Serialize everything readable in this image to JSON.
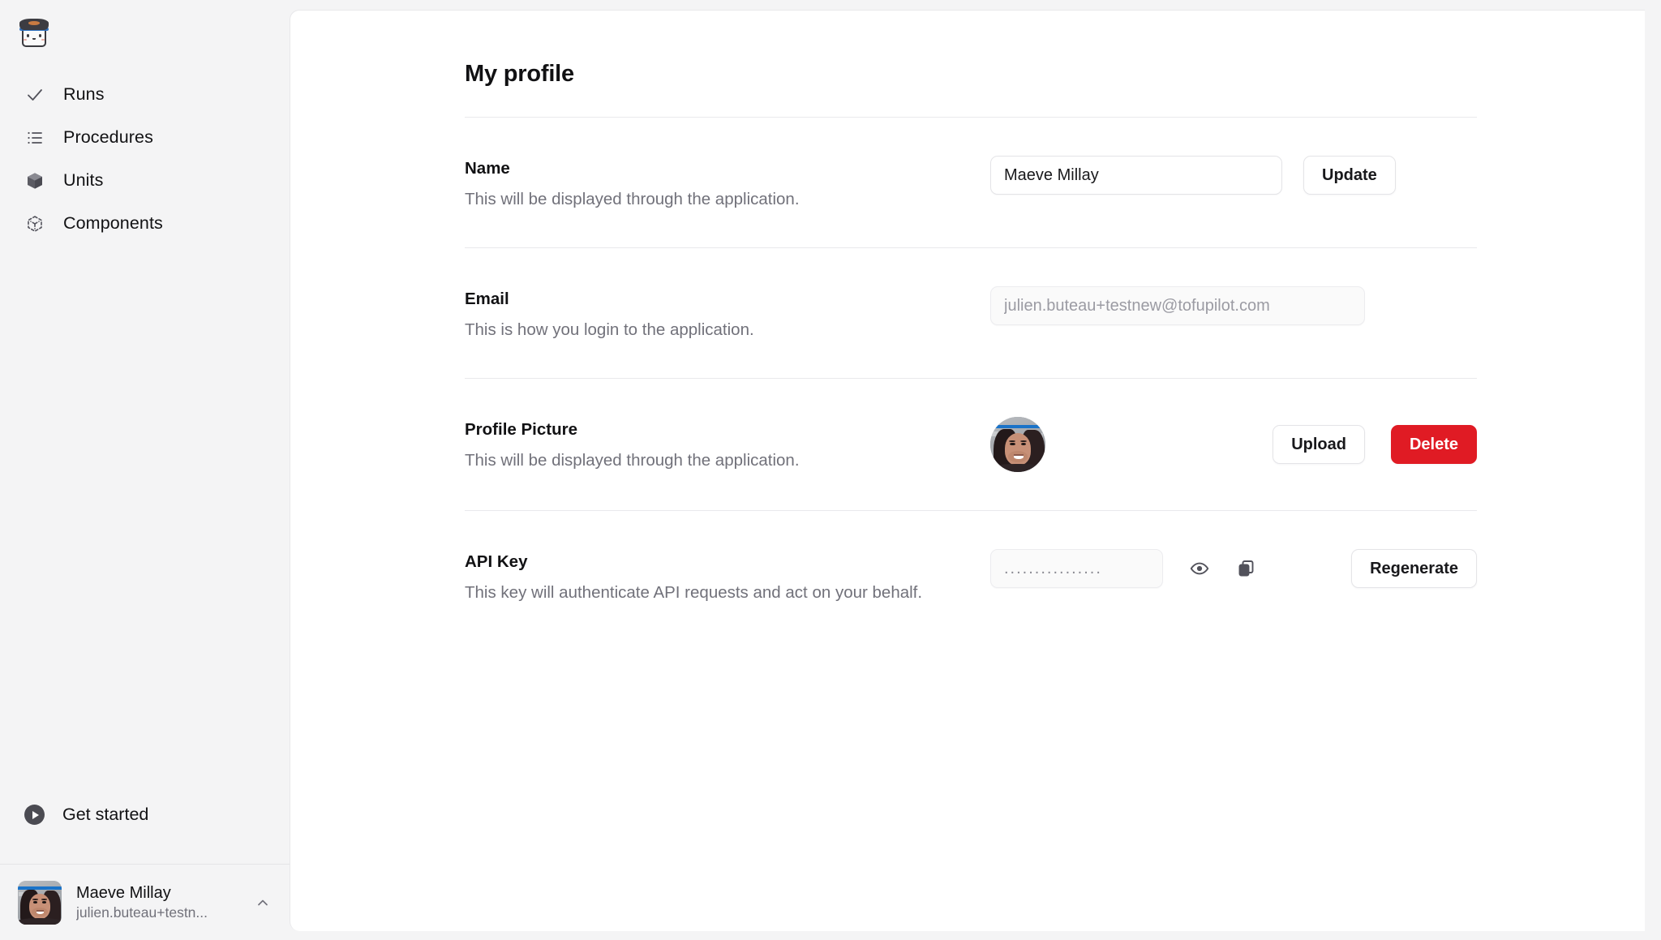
{
  "app": {
    "logo_name": "tofupilot-logo"
  },
  "sidebar": {
    "items": [
      {
        "label": "Runs",
        "icon": "check-icon"
      },
      {
        "label": "Procedures",
        "icon": "list-icon"
      },
      {
        "label": "Units",
        "icon": "cube-icon"
      },
      {
        "label": "Components",
        "icon": "components-icon"
      }
    ],
    "get_started": {
      "label": "Get started",
      "icon": "play-circle-icon"
    },
    "user": {
      "name": "Maeve Millay",
      "email": "julien.buteau+testn...",
      "chevron": "chevron-up-icon",
      "avatar": "user-avatar"
    }
  },
  "main": {
    "title": "My profile",
    "sections": [
      {
        "title": "Name",
        "description": "This will be displayed through the application.",
        "input_value": "Maeve Millay",
        "input_placeholder": "Name",
        "button": "Update"
      },
      {
        "title": "Email",
        "description": "This is how you login to the application.",
        "input_value": "julien.buteau+testnew@tofupilot.com",
        "input_placeholder": "Email"
      },
      {
        "title": "Profile Picture",
        "description": "This will be displayed through the application.",
        "upload_button": "Upload",
        "delete_button": "Delete"
      },
      {
        "title": "API Key",
        "description": "This key will authenticate API requests and act on your behalf.",
        "input_value": "................",
        "reveal_icon": "eye-icon",
        "copy_icon": "copy-icon",
        "button": "Regenerate"
      }
    ]
  },
  "colors": {
    "page_background": "#f4f4f5",
    "panel_background": "#ffffff",
    "text_primary": "#111113",
    "text_muted": "#71717a",
    "border": "#e4e4e7",
    "danger": "#e01b24",
    "logo_band": "#2f73c2"
  }
}
